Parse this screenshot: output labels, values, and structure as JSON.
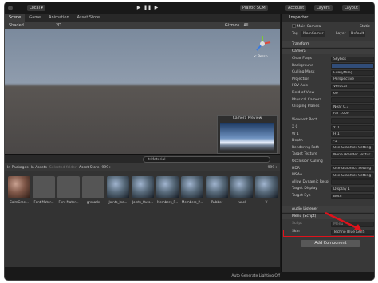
{
  "toolbar": {
    "account": "Local",
    "plastic_scm": "Plastic SCM",
    "account_menu": "Account",
    "layers_menu": "Layers",
    "layout_menu": "Layout"
  },
  "scene_tabs": [
    "Scene",
    "Game",
    "Animation",
    "Asset Store"
  ],
  "scene_toolbar": {
    "shading": "Shaded",
    "mode": "2D",
    "gizmos": "Gizmos",
    "search": "All"
  },
  "viewport": {
    "persp_label": "< Persp",
    "preview_title": "Camera Preview"
  },
  "project": {
    "search_value": "t:Material",
    "filters": [
      "In Packages",
      "In Assets",
      "Selected folder",
      "Asset Store: 999+",
      "999+"
    ],
    "assets": [
      {
        "label": "CalmGree...",
        "kind": "brown"
      },
      {
        "label": "Font Mater...",
        "kind": "font"
      },
      {
        "label": "Font Mater...",
        "kind": "font"
      },
      {
        "label": "grenade",
        "kind": "font"
      },
      {
        "label": "Joints_Ina...",
        "kind": "sky"
      },
      {
        "label": "Joints_Outs...",
        "kind": "sky"
      },
      {
        "label": "Members_F...",
        "kind": "sky"
      },
      {
        "label": "Members_P...",
        "kind": "sky"
      },
      {
        "label": "Rubber",
        "kind": "sky"
      },
      {
        "label": "runel",
        "kind": "sky"
      },
      {
        "label": "V",
        "kind": "sky"
      }
    ]
  },
  "status": {
    "text": "Auto Generate Lighting Off"
  },
  "inspector": {
    "tab": "Inspector",
    "object_name": "Main Camera",
    "static_label": "Static",
    "tag_label": "Tag",
    "tag_value": "MainCamer",
    "layer_label": "Layer",
    "layer_value": "Default",
    "components": {
      "transform": "Transform",
      "camera": "Camera",
      "audio": "Audio Listener",
      "menu": "Menu (Script)"
    },
    "props": [
      {
        "k": "Clear Flags",
        "v": "Skybox"
      },
      {
        "k": "Background",
        "v": ""
      },
      {
        "k": "Culling Mask",
        "v": "Everything"
      },
      {
        "k": "Projection",
        "v": "Perspective"
      },
      {
        "k": "FOV Axis",
        "v": "Vertical"
      },
      {
        "k": "Field of View",
        "v": "60"
      },
      {
        "k": "Physical Camera",
        "v": ""
      },
      {
        "k": "Clipping Planes",
        "v": "Near 0.3"
      },
      {
        "k": "",
        "v": "Far 1000"
      },
      {
        "k": "Viewport Rect",
        "v": ""
      },
      {
        "k": "X 0",
        "v": "Y 0"
      },
      {
        "k": "W 1",
        "v": "H 1"
      },
      {
        "k": "Depth",
        "v": "-1"
      },
      {
        "k": "Rendering Path",
        "v": "Use Graphics Setting"
      },
      {
        "k": "Target Texture",
        "v": "None (Render Textur"
      },
      {
        "k": "Occlusion Culling",
        "v": ""
      },
      {
        "k": "HDR",
        "v": "Use Graphics Setting"
      },
      {
        "k": "MSAA",
        "v": "Use Graphics Setting"
      },
      {
        "k": "Allow Dynamic Resol",
        "v": ""
      },
      {
        "k": "Target Display",
        "v": "Display 1"
      },
      {
        "k": "Target Eye",
        "v": "Both"
      }
    ],
    "script_label": "Script",
    "script_value": "Menu",
    "skin_label": "Skin",
    "skin_value": "Techno Blue GUIS",
    "add_component": "Add Component"
  },
  "colors": {
    "highlight": "#e0121b",
    "background_swatch": "#314d79"
  }
}
